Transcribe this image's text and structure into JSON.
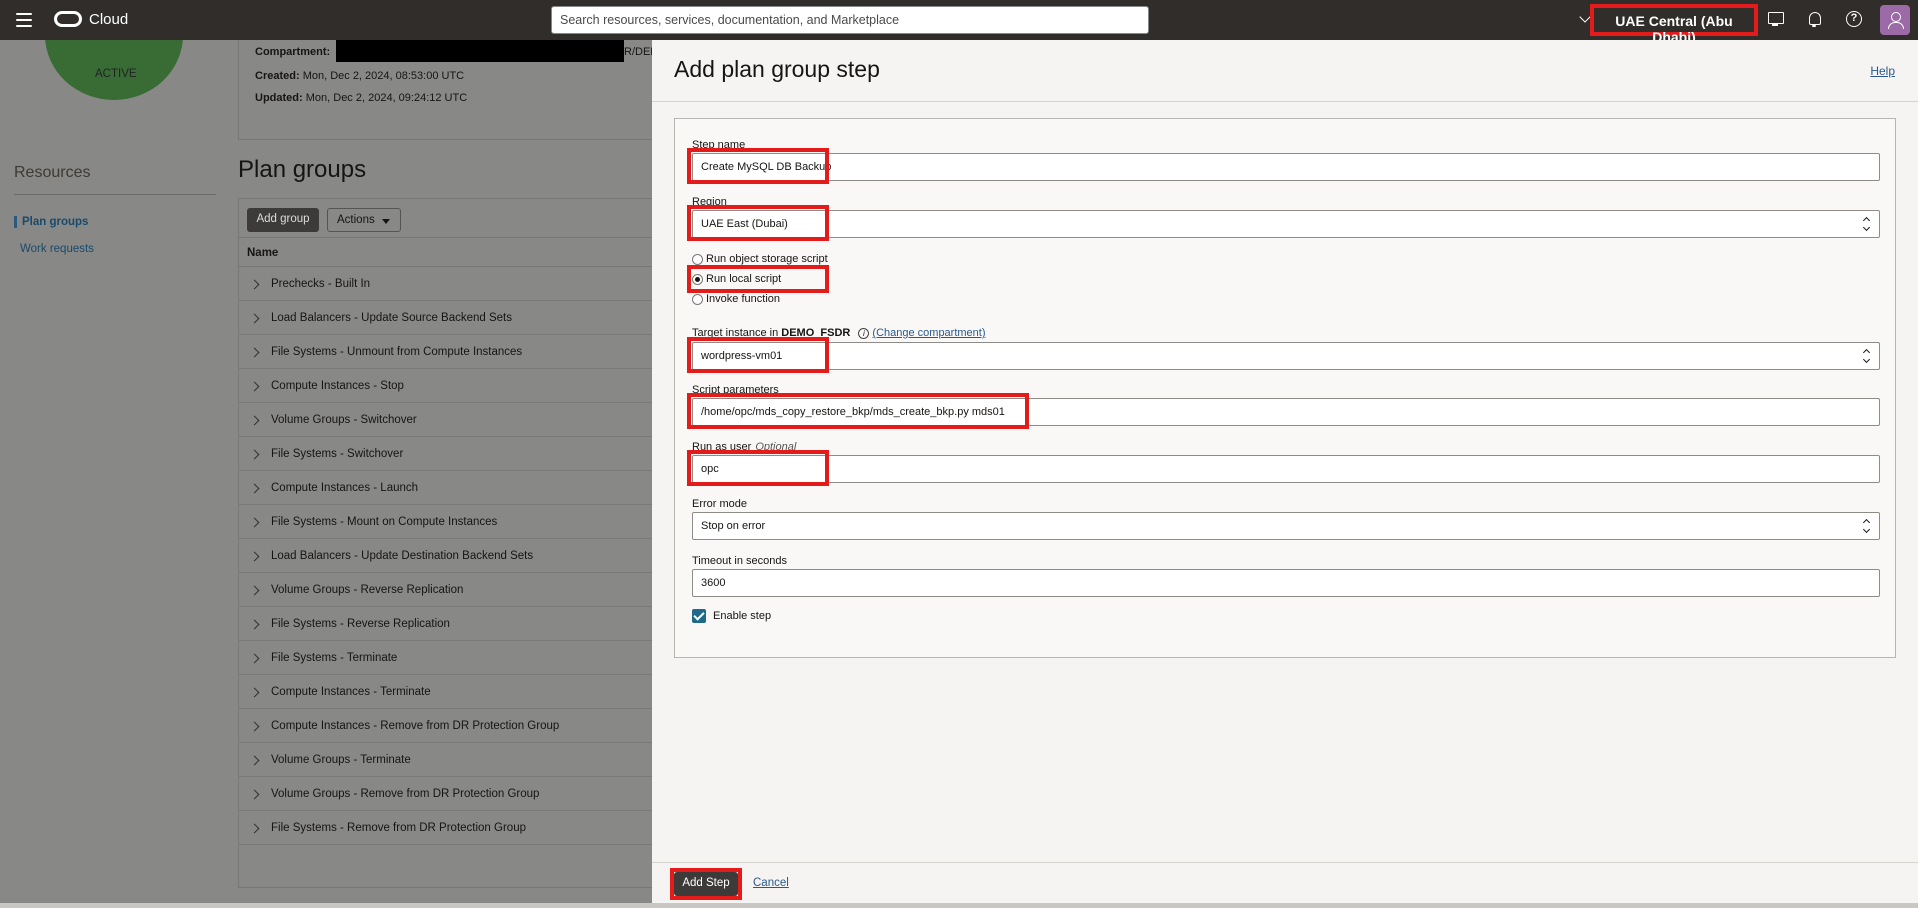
{
  "topbar": {
    "brand": "Cloud",
    "search_placeholder": "Search resources, services, documentation, and Marketplace",
    "region": "UAE Central (Abu Dhabi)",
    "icons": [
      "menu-icon",
      "oracle-logo-icon",
      "chevron-down-icon",
      "cloud-shell-icon",
      "bell-icon",
      "help-icon",
      "profile-icon"
    ]
  },
  "background": {
    "status": "ACTIVE",
    "compartment_label": "Compartment:",
    "compartment_tail": "R/DEM",
    "created_label": "Created:",
    "created_value": "Mon, Dec 2, 2024, 08:53:00 UTC",
    "updated_label": "Updated:",
    "updated_value": "Mon, Dec 2, 2024, 09:24:12 UTC",
    "resources_title": "Resources",
    "resources": [
      "Plan groups",
      "Work requests"
    ],
    "plan_groups_title": "Plan groups",
    "add_group_label": "Add group",
    "actions_label": "Actions",
    "table_header": "Name",
    "rows": [
      "Prechecks - Built In",
      "Load Balancers - Update Source Backend Sets",
      "File Systems - Unmount from Compute Instances",
      "Compute Instances - Stop",
      "Volume Groups - Switchover",
      "File Systems - Switchover",
      "Compute Instances - Launch",
      "File Systems - Mount on Compute Instances",
      "Load Balancers - Update Destination Backend Sets",
      "Volume Groups - Reverse Replication",
      "File Systems - Reverse Replication",
      "File Systems - Terminate",
      "Compute Instances - Terminate",
      "Compute Instances - Remove from DR Protection Group",
      "Volume Groups - Terminate",
      "Volume Groups - Remove from DR Protection Group",
      "File Systems - Remove from DR Protection Group"
    ]
  },
  "panel": {
    "title": "Add plan group step",
    "help_label": "Help",
    "step_name_label": "Step name",
    "step_name_value": "Create MySQL DB Backup",
    "region_label": "Region",
    "region_value": "UAE East (Dubai)",
    "radio_options": [
      "Run object storage script",
      "Run local script",
      "Invoke function"
    ],
    "radio_selected": "Run local script",
    "target_label_prefix": "Target instance in",
    "target_compartment": "DEMO_FSDR",
    "change_compartment_label": "(Change compartment)",
    "target_value": "wordpress-vm01",
    "script_params_label": "Script parameters",
    "script_params_value": "/home/opc/mds_copy_restore_bkp/mds_create_bkp.py mds01",
    "run_as_label": "Run as user",
    "run_as_optional": "Optional",
    "run_as_value": "opc",
    "error_mode_label": "Error mode",
    "error_mode_value": "Stop on error",
    "timeout_label": "Timeout in seconds",
    "timeout_value": "3600",
    "enable_step_label": "Enable step",
    "enable_step_checked": true,
    "add_step_label": "Add Step",
    "cancel_label": "Cancel"
  },
  "colors": {
    "topbar_bg": "#312d2a",
    "highlight": "#e31b1b",
    "link": "#2a5a8a",
    "checkbox": "#1f6a8a",
    "status_green": "#396b35"
  }
}
